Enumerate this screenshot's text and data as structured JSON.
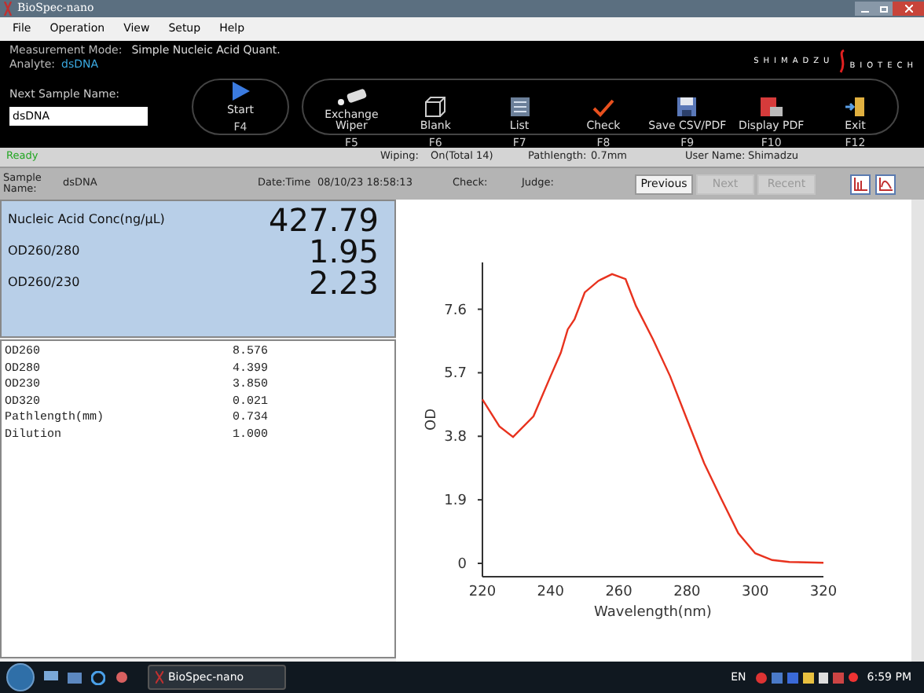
{
  "window": {
    "title": "BioSpec-nano"
  },
  "menu": [
    "File",
    "Operation",
    "View",
    "Setup",
    "Help"
  ],
  "info": {
    "mode_label": "Measurement Mode:",
    "mode": "Simple Nucleic Acid Quant.",
    "analyte_label": "Analyte:",
    "analyte": "dsDNA"
  },
  "logo": {
    "top": "SHIMADZU",
    "bottom": "BIOTECH"
  },
  "next_sample": {
    "label": "Next Sample Name:",
    "value": "dsDNA"
  },
  "toolbar": [
    {
      "kind": "start",
      "label": "Start",
      "key": "F4"
    },
    {
      "kind": "wiper",
      "label": "Exchange Wiper",
      "key": "F5"
    },
    {
      "kind": "blank",
      "label": "Blank",
      "key": "F6"
    },
    {
      "kind": "list",
      "label": "List",
      "key": "F7"
    },
    {
      "kind": "check",
      "label": "Check",
      "key": "F8"
    },
    {
      "kind": "save",
      "label": "Save CSV/PDF",
      "key": "F9"
    },
    {
      "kind": "pdf",
      "label": "Display PDF",
      "key": "F10"
    },
    {
      "kind": "exit",
      "label": "Exit",
      "key": "F12"
    }
  ],
  "status": {
    "state": "Ready",
    "wiping_label": "Wiping:",
    "wiping": "On(Total 14)",
    "path_label": "Pathlength:",
    "path": "0.7mm",
    "user_label": "User Name:",
    "user": "Shimadzu"
  },
  "sample_bar": {
    "name_label": "Sample Name:",
    "name": "dsDNA",
    "date_label": "Date:Time",
    "date": "08/10/23 18:58:13",
    "check_label": "Check:",
    "judge_label": "Judge:",
    "buttons": [
      {
        "label": "Previous",
        "disabled": false
      },
      {
        "label": "Next",
        "disabled": true
      },
      {
        "label": "Recent",
        "disabled": true
      }
    ]
  },
  "results": [
    {
      "label": "Nucleic Acid Conc(ng/µL)",
      "value": "427.79"
    },
    {
      "label": "OD260/280",
      "value": "1.95"
    },
    {
      "label": "OD260/230",
      "value": "2.23"
    }
  ],
  "details": [
    {
      "label": "OD260",
      "value": "8.576"
    },
    {
      "label": "OD280",
      "value": "4.399"
    },
    {
      "label": "OD230",
      "value": "3.850"
    },
    {
      "label": "OD320",
      "value": "0.021"
    },
    {
      "label": "Pathlength(mm)",
      "value": "0.734"
    },
    {
      "label": "Dilution",
      "value": "1.000"
    }
  ],
  "chart_data": {
    "type": "line",
    "xlabel": "Wavelength(nm)",
    "ylabel": "OD",
    "xlim": [
      220,
      320
    ],
    "ylim": [
      -0.4,
      9.0
    ],
    "xticks": [
      220,
      240,
      260,
      280,
      300,
      320
    ],
    "yticks": [
      0,
      1.9,
      3.8,
      5.7,
      7.6
    ],
    "x": [
      220,
      225,
      229,
      235,
      240,
      243,
      245,
      247,
      250,
      254,
      258,
      262,
      265,
      270,
      275,
      280,
      285,
      290,
      295,
      300,
      305,
      310,
      320
    ],
    "series": [
      {
        "color": "#e8321e",
        "values": [
          4.9,
          4.1,
          3.78,
          4.4,
          5.6,
          6.3,
          7.0,
          7.3,
          8.1,
          8.45,
          8.65,
          8.5,
          7.7,
          6.7,
          5.6,
          4.3,
          3.0,
          1.94,
          0.9,
          0.3,
          0.1,
          0.04,
          0.02
        ]
      }
    ]
  },
  "taskbar": {
    "task": "BioSpec-nano",
    "lang": "EN",
    "time": "6:59 PM"
  }
}
